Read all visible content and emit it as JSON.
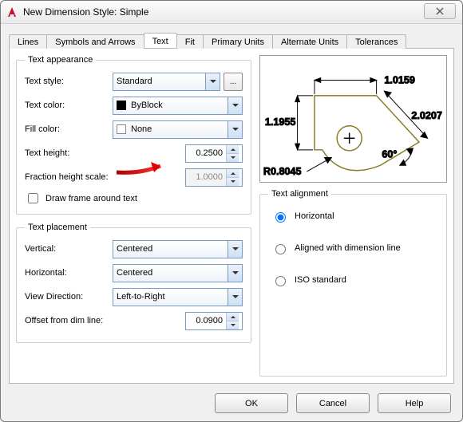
{
  "window": {
    "title": "New Dimension Style: Simple"
  },
  "tabs": [
    "Lines",
    "Symbols and Arrows",
    "Text",
    "Fit",
    "Primary Units",
    "Alternate Units",
    "Tolerances"
  ],
  "active_tab": "Text",
  "appearance": {
    "legend": "Text appearance",
    "style_lbl": "Text style:",
    "style_val": "Standard",
    "color_lbl": "Text color:",
    "color_val": "ByBlock",
    "fill_lbl": "Fill color:",
    "fill_val": "None",
    "height_lbl": "Text height:",
    "height_val": "0.2500",
    "fraction_lbl": "Fraction height scale:",
    "fraction_val": "1.0000",
    "frame_lbl": "Draw frame around text"
  },
  "placement": {
    "legend": "Text placement",
    "vert_lbl": "Vertical:",
    "vert_val": "Centered",
    "horiz_lbl": "Horizontal:",
    "horiz_val": "Centered",
    "viewdir_lbl": "View Direction:",
    "viewdir_val": "Left-to-Right",
    "offset_lbl": "Offset from dim line:",
    "offset_val": "0.0900"
  },
  "alignment": {
    "legend": "Text alignment",
    "opt1": "Horizontal",
    "opt2": "Aligned with dimension line",
    "opt3": "ISO standard"
  },
  "preview": {
    "dim_top": "1.0159",
    "dim_left": "1.1955",
    "dim_right": "2.0207",
    "angle": "60°",
    "radius": "R0.8045"
  },
  "buttons": {
    "ok": "OK",
    "cancel": "Cancel",
    "help": "Help",
    "browse": "..."
  }
}
